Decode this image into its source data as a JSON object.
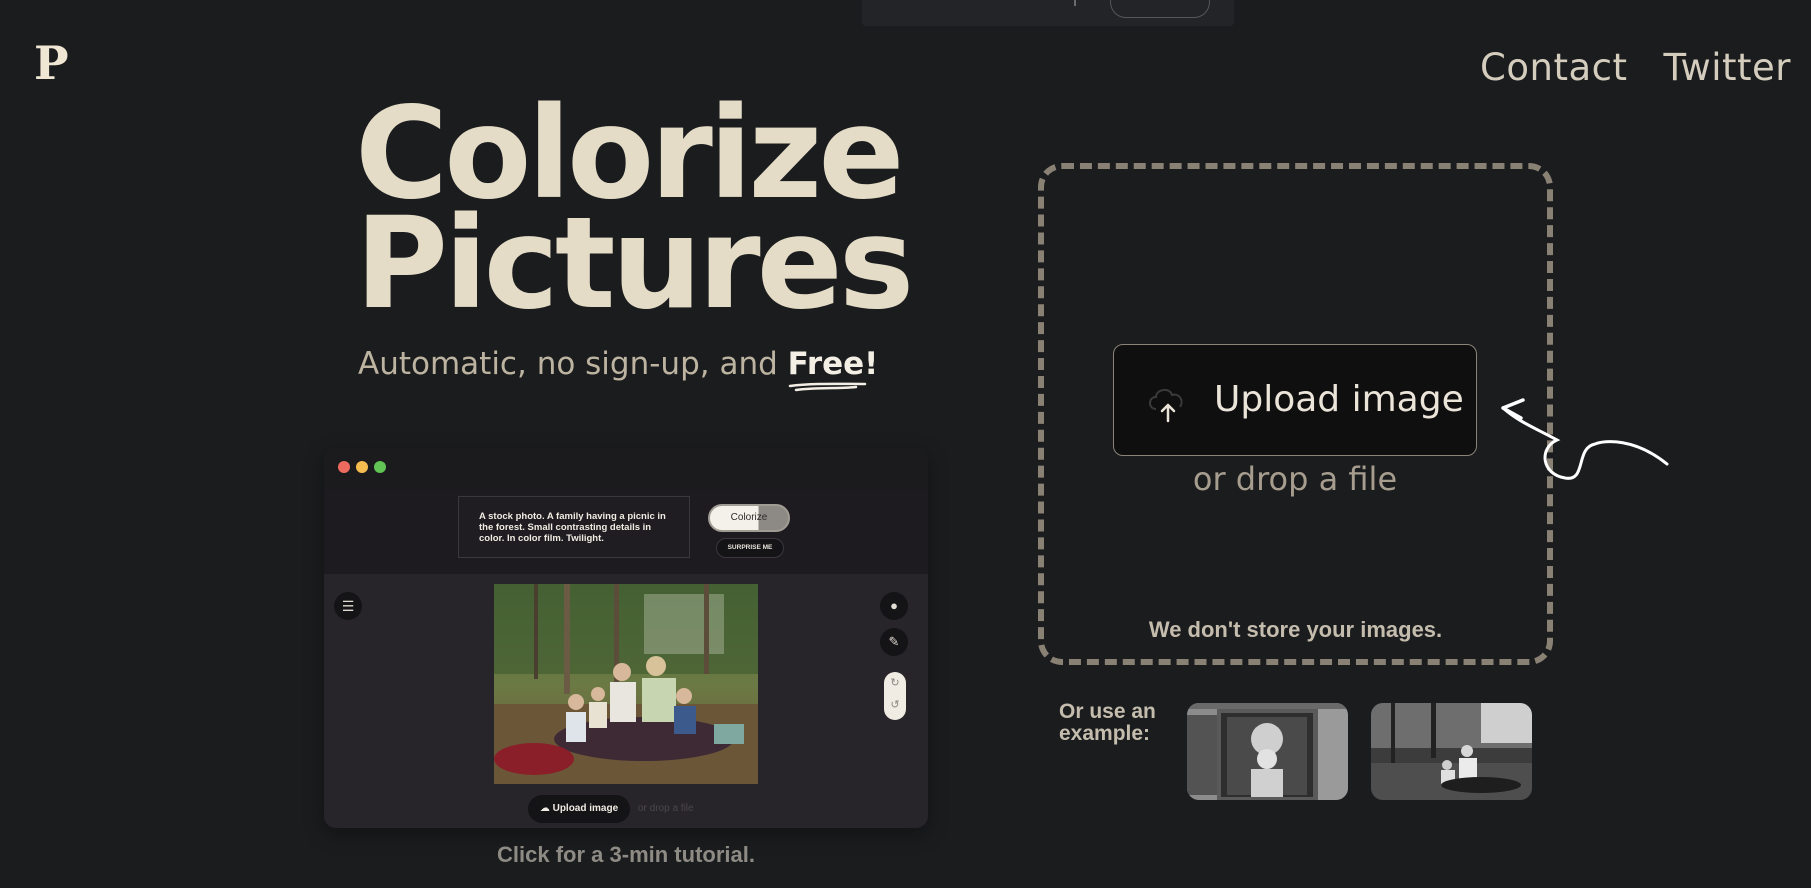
{
  "brand": {
    "logo": "P"
  },
  "nav": {
    "contact": "Contact",
    "twitter": "Twitter"
  },
  "hero": {
    "title_line1": "Colorize",
    "title_line2": "Pictures",
    "subtitle_prefix": "Automatic, no sign-up, and ",
    "subtitle_emphasis": "Free!"
  },
  "demo": {
    "prompt": "A stock photo. A family having a picnic in the forest. Small contrasting details in color. In color film. Twilight.",
    "colorize_label": "Colorize",
    "surprise_label": "SURPRISE ME",
    "upload_label": "Upload image",
    "drop_label": "or drop a file",
    "caption": "Click for a 3-min tutorial."
  },
  "upload": {
    "button_label": "Upload image",
    "drop_text": "or drop a file",
    "privacy_note": "We don't store your images."
  },
  "examples": {
    "label_line1": "Or use an",
    "label_line2": "example:"
  },
  "colors": {
    "background": "#1b1c1e",
    "title": "#e4dcc7",
    "dashed_border": "#8a8175"
  }
}
